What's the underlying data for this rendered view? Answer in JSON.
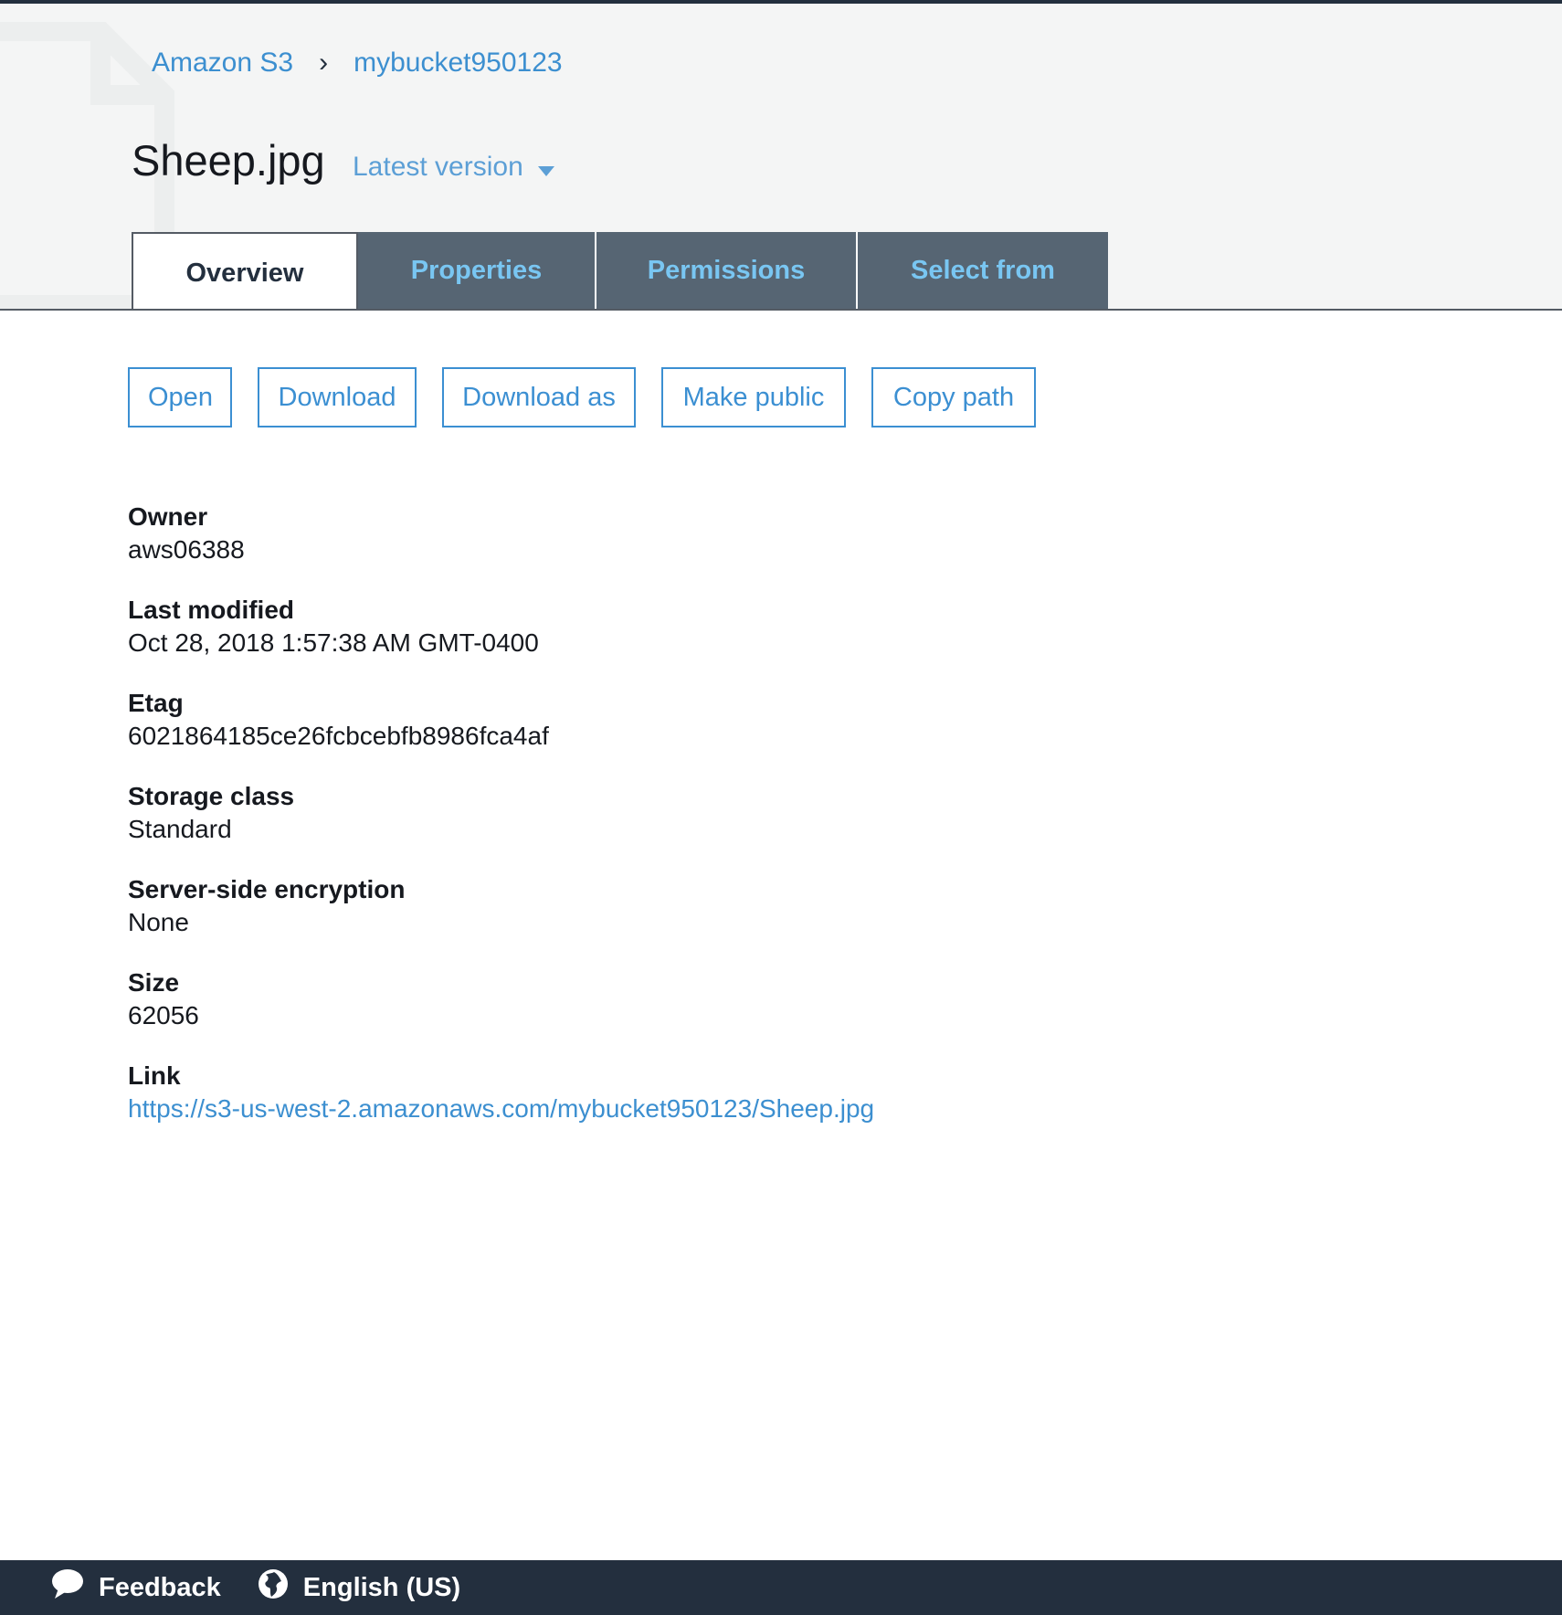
{
  "breadcrumb": {
    "root": "Amazon S3",
    "separator": "›",
    "bucket": "mybucket950123"
  },
  "object": {
    "name": "Sheep.jpg",
    "version_label": "Latest version"
  },
  "tabs": [
    {
      "label": "Overview",
      "active": true
    },
    {
      "label": "Properties",
      "active": false
    },
    {
      "label": "Permissions",
      "active": false
    },
    {
      "label": "Select from",
      "active": false
    }
  ],
  "actions": {
    "open": "Open",
    "download": "Download",
    "download_as": "Download as",
    "make_public": "Make public",
    "copy_path": "Copy path"
  },
  "details": {
    "owner": {
      "label": "Owner",
      "value": "aws06388"
    },
    "last_modified": {
      "label": "Last modified",
      "value": "Oct 28, 2018 1:57:38 AM GMT-0400"
    },
    "etag": {
      "label": "Etag",
      "value": "6021864185ce26fcbcebfb8986fca4af"
    },
    "storage_class": {
      "label": "Storage class",
      "value": "Standard"
    },
    "encryption": {
      "label": "Server-side encryption",
      "value": "None"
    },
    "size": {
      "label": "Size",
      "value": "62056"
    },
    "link": {
      "label": "Link",
      "value": "https://s3-us-west-2.amazonaws.com/mybucket950123/Sheep.jpg"
    }
  },
  "footer": {
    "feedback": "Feedback",
    "language": "English (US)"
  },
  "icons": {
    "file_watermark": "file-icon",
    "caret": "caret-down-icon",
    "feedback": "speech-bubble-icon",
    "language": "globe-icon"
  },
  "colors": {
    "header_bg": "#f4f5f5",
    "link": "#3c8fd0",
    "tab_inactive_bg": "#566573",
    "tab_inactive_text": "#79c6f2",
    "footer_bg": "#232f3e"
  }
}
